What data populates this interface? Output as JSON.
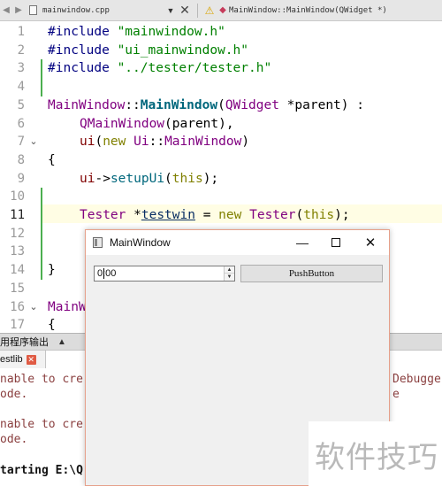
{
  "tab_bar": {
    "file_name": "mainwindow.cpp",
    "symbol": "MainWindow::MainWindow(QWidget *)"
  },
  "editor": {
    "line_numbers": [
      "1",
      "2",
      "3",
      "4",
      "5",
      "6",
      "7",
      "8",
      "9",
      "10",
      "11",
      "12",
      "13",
      "14",
      "15",
      "16",
      "17"
    ],
    "current_line": "11",
    "lines": {
      "l1_a": "#include ",
      "l1_b": "\"mainwindow.h\"",
      "l2_a": "#include ",
      "l2_b": "\"ui_mainwindow.h\"",
      "l3_a": "#include ",
      "l3_b": "\"../tester/tester.h\"",
      "l5_a": "MainWindow",
      "l5_b": "::",
      "l5_c": "MainWindow",
      "l5_d": "(",
      "l5_e": "QWidget",
      "l5_f": " *parent) :",
      "l6_a": "QMainWindow",
      "l6_b": "(parent),",
      "l7_a": "ui",
      "l7_b": "(",
      "l7_c": "new",
      "l7_d": " ",
      "l7_e": "Ui",
      "l7_f": "::",
      "l7_g": "MainWindow",
      "l7_h": ")",
      "l8": "{",
      "l9_a": "ui",
      "l9_b": "->",
      "l9_c": "setupUi",
      "l9_d": "(",
      "l9_e": "this",
      "l9_f": ");",
      "l11_a": "Tester",
      "l11_b": " *",
      "l11_c": "testwin",
      "l11_d": " = ",
      "l11_e": "new",
      "l11_f": " ",
      "l11_g": "Tester",
      "l11_h": "(",
      "l11_i": "this",
      "l11_j": ");",
      "l14": "}",
      "l16": "MainW",
      "l17": "{"
    }
  },
  "output_pane": {
    "title": "用程序输出",
    "tab_label": "estlib",
    "lines": [
      "nable to cre",
      "ode.",
      "nable to cre",
      "ode.",
      "tarting E:\\Q"
    ],
    "right_fragments": [
      "Debugge",
      "e"
    ]
  },
  "main_window": {
    "title": "MainWindow",
    "time_value": "0:00",
    "push_button_label": "PushButton"
  },
  "watermark": "软件技巧",
  "colors": {
    "keyword": "#808000",
    "string": "#008000",
    "class": "#800080",
    "function": "#00677c",
    "change_bar": "#4caf50",
    "window_border": "#e6a08a"
  }
}
